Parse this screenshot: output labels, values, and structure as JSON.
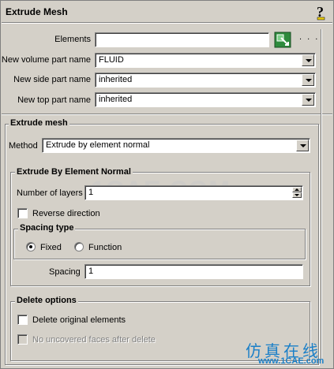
{
  "title": "Extrude Mesh",
  "fields": {
    "elements_label": "Elements",
    "elements_value": "",
    "more_dots": ". . .",
    "volume_label": "New volume part name",
    "volume_value": "FLUID",
    "side_label": "New side part name",
    "side_value": "inherited",
    "top_label": "New top part name",
    "top_value": "inherited"
  },
  "extrude_mesh": {
    "title": "Extrude mesh",
    "method_label": "Method",
    "method_value": "Extrude by element normal"
  },
  "normal_group": {
    "title": "Extrude By Element Normal",
    "layers_label": "Number of layers",
    "layers_value": "1",
    "reverse_label": "Reverse direction",
    "spacing_type_title": "Spacing type",
    "fixed_label": "Fixed",
    "function_label": "Function",
    "spacing_label": "Spacing",
    "spacing_value": "1"
  },
  "delete_options": {
    "title": "Delete options",
    "delete_label": "Delete original elements",
    "no_uncovered_label": "No uncovered faces after delete"
  },
  "watermark": "1CAE.COM",
  "logo": {
    "cn": "仿真在线",
    "en": "www.1CAE.com"
  },
  "colors": {
    "panel": "#d4d0c8",
    "logo_blue": "#1a7fc8",
    "help_yellow": "#f0d000"
  },
  "icons": [
    "help-icon",
    "select-elements-icon"
  ]
}
